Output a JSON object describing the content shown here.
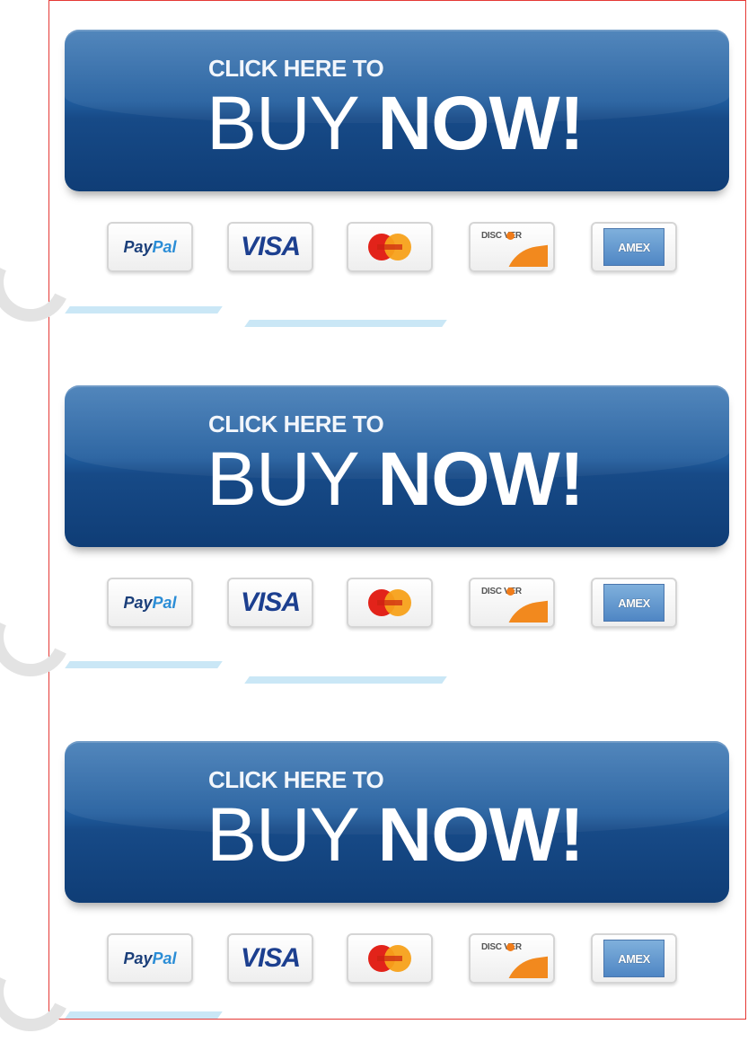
{
  "buttons": [
    {
      "top_text": "CLICK HERE TO",
      "main_thin": "BUY",
      "main_bold": "NOW!"
    },
    {
      "top_text": "CLICK HERE TO",
      "main_thin": "BUY",
      "main_bold": "NOW!"
    },
    {
      "top_text": "CLICK HERE TO",
      "main_thin": "BUY",
      "main_bold": "NOW!"
    }
  ],
  "payment_methods": {
    "paypal_a": "Pay",
    "paypal_b": "Pal",
    "visa": "VISA",
    "discover": "DISC VER",
    "amex": "AMEX"
  },
  "colors": {
    "button": "#1f5b9c",
    "frame_border": "#e53935",
    "visa": "#1c3f8f",
    "mastercard_red": "#e2231a",
    "mastercard_yellow": "#f7a11a",
    "discover_orange": "#f2891e"
  },
  "icons": [
    "paypal-logo-icon",
    "visa-logo-icon",
    "mastercard-logo-icon",
    "discover-logo-icon",
    "amex-logo-icon"
  ]
}
